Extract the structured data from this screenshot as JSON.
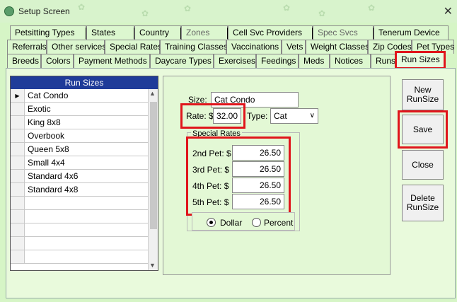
{
  "window": {
    "title": "Setup Screen",
    "close_glyph": "✕"
  },
  "tabs": {
    "row1": [
      "Petsitting Types",
      "States",
      "Country",
      "Zones",
      "Cell Svc Providers",
      "Spec Svcs",
      "Tenerum Device"
    ],
    "row2": [
      "Referrals",
      "Other services",
      "Special Rates",
      "Training Classes",
      "Vaccinations",
      "Vets",
      "Weight Classes",
      "Zip Codes",
      "Pet Types"
    ],
    "row3": [
      "Breeds",
      "Colors",
      "Payment Methods",
      "Daycare Types",
      "Exercises",
      "Feedings",
      "Meds",
      "Notices",
      "Runs",
      "Run Sizes"
    ],
    "active": "Run Sizes"
  },
  "grid": {
    "header": "Run Sizes",
    "rows": [
      "Cat Condo",
      "Exotic",
      "King 8x8",
      "Overbook",
      "Queen 5x8",
      "Small 4x4",
      "Standard 4x6",
      "Standard 4x8",
      "",
      "",
      "",
      "",
      "",
      ""
    ],
    "selected_marker": "▶"
  },
  "detail": {
    "size_label": "Size:",
    "size_value": "Cat Condo",
    "rate_label": "Rate: $",
    "rate_value": "32.00",
    "type_label": "Type:",
    "type_value": "Cat",
    "special_rates_title": "Special Rates",
    "pets": [
      {
        "label": "2nd Pet: $",
        "value": "26.50"
      },
      {
        "label": "3rd Pet: $",
        "value": "26.50"
      },
      {
        "label": "4th Pet: $",
        "value": "26.50"
      },
      {
        "label": "5th Pet: $",
        "value": "26.50"
      }
    ],
    "dollar_label": "Dollar",
    "percent_label": "Percent"
  },
  "buttons": {
    "new": "New\nRunSize",
    "save": "Save",
    "close": "Close",
    "delete": "Delete\nRunSize"
  },
  "colors": {
    "highlight": "#e0151b",
    "grid_header": "#1f3c99",
    "background": "#d6f5c6"
  }
}
